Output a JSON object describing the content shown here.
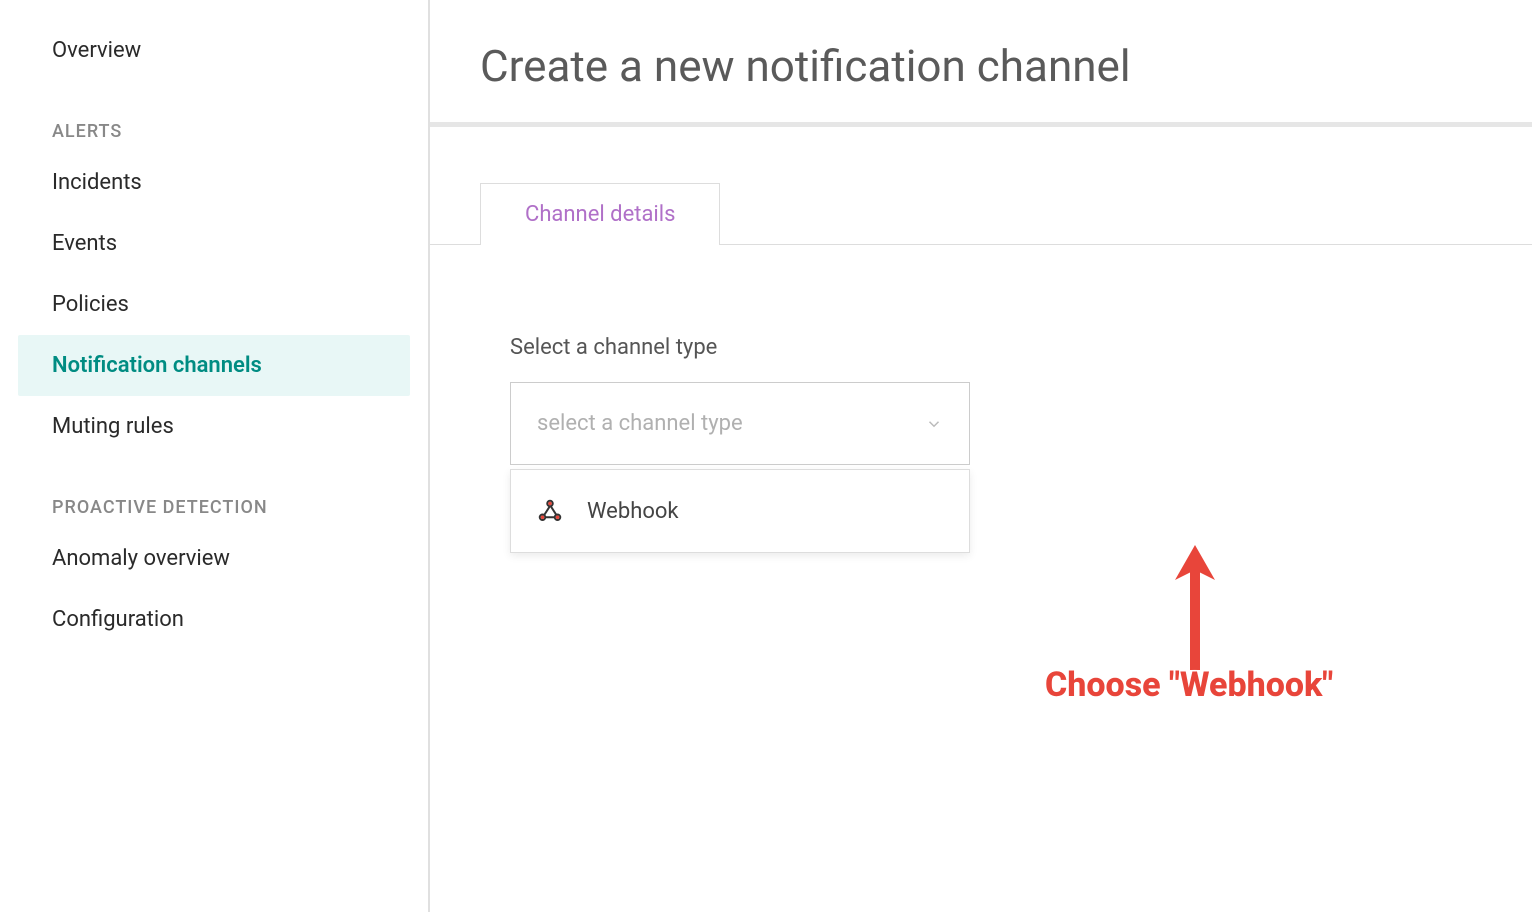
{
  "sidebar": {
    "items": [
      {
        "label": "Overview",
        "active": false
      }
    ],
    "sections": [
      {
        "heading": "ALERTS",
        "items": [
          {
            "label": "Incidents",
            "active": false
          },
          {
            "label": "Events",
            "active": false
          },
          {
            "label": "Policies",
            "active": false
          },
          {
            "label": "Notification channels",
            "active": true
          },
          {
            "label": "Muting rules",
            "active": false
          }
        ]
      },
      {
        "heading": "PROACTIVE DETECTION",
        "items": [
          {
            "label": "Anomaly overview",
            "active": false
          },
          {
            "label": "Configuration",
            "active": false
          }
        ]
      }
    ]
  },
  "page": {
    "title": "Create a new notification channel"
  },
  "tabs": {
    "active": "Channel details"
  },
  "form": {
    "channel_type_label": "Select a channel type",
    "channel_type_placeholder": "select a channel type",
    "dropdown_options": [
      {
        "label": "Webhook",
        "icon": "webhook-icon"
      }
    ]
  },
  "annotation": {
    "text": "Choose \"Webhook\""
  }
}
